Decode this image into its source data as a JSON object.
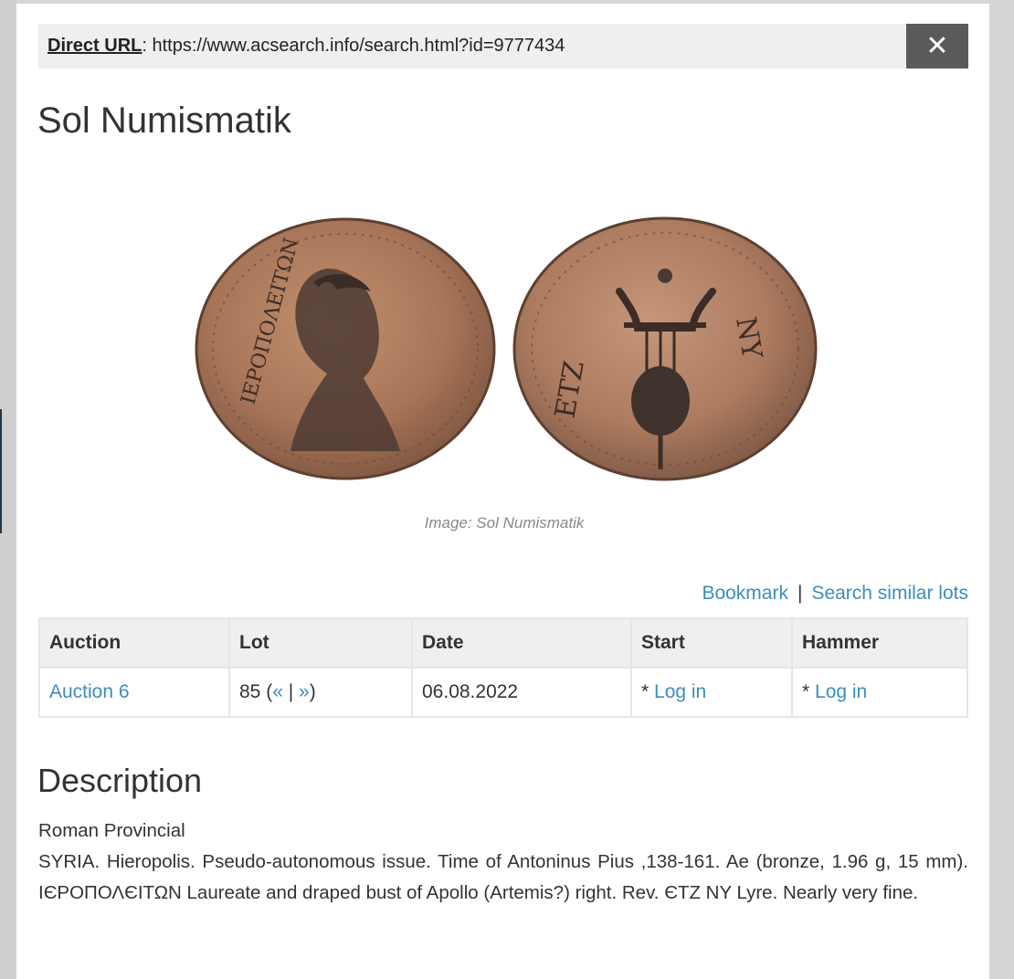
{
  "direct_url": {
    "label": "Direct URL",
    "separator": ":",
    "value": "https://www.acsearch.info/search.html?id=9777434"
  },
  "close": {
    "glyph": "✕",
    "icon": "close-icon"
  },
  "seller": "Sol Numismatik",
  "image": {
    "caption": "Image: Sol Numismatik",
    "obverse_legend": "ΙΕΡΟΠΟΛΕΙΤΩΝ",
    "reverse_left_legend": "ΕΤΖ",
    "reverse_right_legend": "ΝΥ"
  },
  "actions": {
    "bookmark": "Bookmark",
    "separator": "|",
    "similar": "Search similar lots"
  },
  "table": {
    "headers": [
      "Auction",
      "Lot",
      "Date",
      "Start",
      "Hammer"
    ],
    "row": {
      "auction": "Auction 6",
      "lot_number": "85",
      "prev": "«",
      "nav_sep": "|",
      "next": "»",
      "date": "06.08.2022",
      "start_prefix": "* ",
      "start_link": "Log in",
      "hammer_prefix": "* ",
      "hammer_link": "Log in"
    }
  },
  "description": {
    "title": "Description",
    "category": "Roman Provincial",
    "text": "SYRIA. Hieropolis. Pseudo-autonomous issue. Time of Antoninus Pius ,138-161. Ae (bronze, 1.96 g, 15 mm). ΙЄΡΟΠΟΛЄΙΤΩΝ Laureate and draped bust of Apollo (Artemis?) right. Rev. ЄTZ NY Lyre. Nearly very fine."
  },
  "colors": {
    "link": "#3c8dbc",
    "close_bg": "#5a5a5a",
    "url_bg": "#efefef",
    "coin_bronze": "#a87558"
  }
}
